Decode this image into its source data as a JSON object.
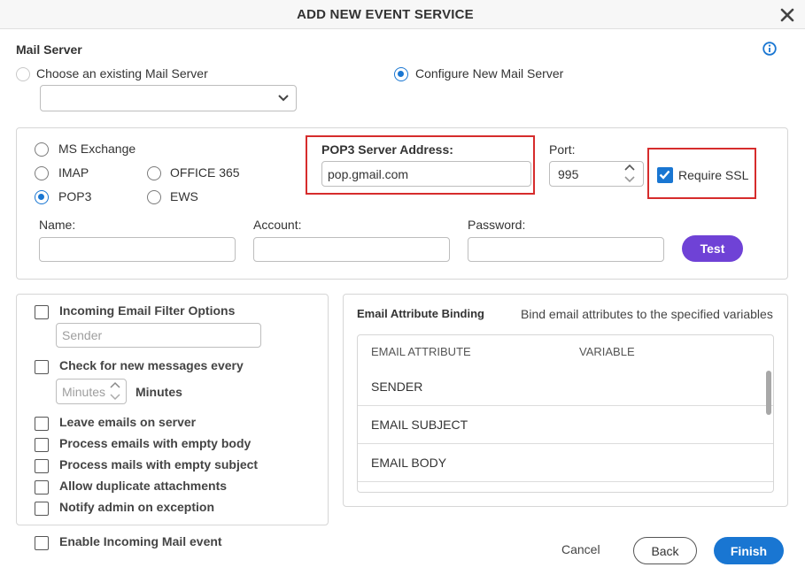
{
  "dialog": {
    "title": "ADD NEW EVENT SERVICE"
  },
  "mail_server": {
    "section_label": "Mail Server",
    "choose_existing_label": "Choose an existing Mail Server",
    "configure_new_label": "Configure New Mail Server",
    "existing_select_value": ""
  },
  "server_types": {
    "ms_exchange": "MS Exchange",
    "imap": "IMAP",
    "pop3": "POP3",
    "office365": "OFFICE 365",
    "ews": "EWS",
    "selected": "POP3"
  },
  "pop3": {
    "address_label": "POP3 Server Address:",
    "address_value": "pop.gmail.com",
    "port_label": "Port:",
    "port_value": "995",
    "ssl_label": "Require SSL",
    "ssl_checked": true
  },
  "credentials": {
    "name_label": "Name:",
    "account_label": "Account:",
    "password_label": "Password:",
    "name_value": "",
    "account_value": "",
    "password_value": "",
    "test_label": "Test"
  },
  "options": {
    "incoming_filter_label": "Incoming Email Filter Options",
    "filter_placeholder": "Sender",
    "check_messages_label": "Check for new messages every",
    "minutes_placeholder": "Minutes",
    "minutes_label": "Minutes",
    "leave_on_server": "Leave emails on server",
    "empty_body": "Process emails with empty body",
    "empty_subject": "Process mails with empty subject",
    "duplicate_attachments": "Allow duplicate attachments",
    "notify_admin": "Notify admin on exception",
    "enable_incoming": "Enable Incoming Mail event"
  },
  "binding": {
    "title": "Email Attribute Binding",
    "description": "Bind email attributes to the specified variables",
    "col_attribute": "EMAIL ATTRIBUTE",
    "col_variable": "VARIABLE",
    "rows": [
      "SENDER",
      "EMAIL SUBJECT",
      "EMAIL BODY"
    ]
  },
  "footer": {
    "cancel": "Cancel",
    "back": "Back",
    "finish": "Finish"
  },
  "colors": {
    "accent": "#1976d2",
    "test_button": "#6f42d6",
    "highlight": "#d62c2c"
  }
}
